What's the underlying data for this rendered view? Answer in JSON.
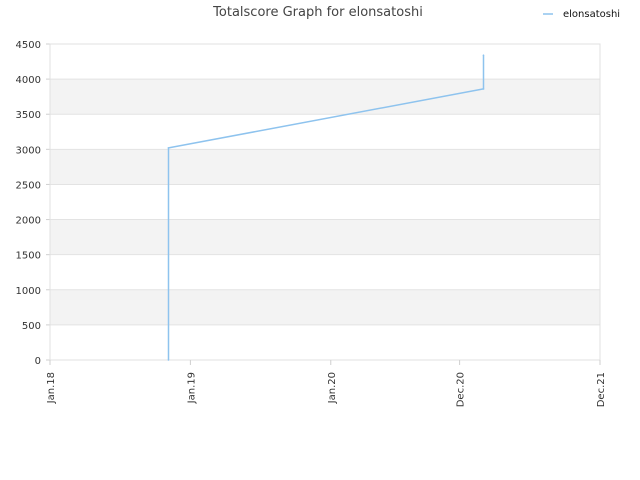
{
  "chart_data": {
    "type": "line",
    "title": "Totalscore Graph for elonsatoshi",
    "xlabel": "",
    "ylabel": "",
    "ylim": [
      0,
      4500
    ],
    "y_ticks": [
      "0",
      "500",
      "1000",
      "1500",
      "2000",
      "2500",
      "3000",
      "3500",
      "4000",
      "4500"
    ],
    "x_ticks": [
      {
        "label": "Jan.18",
        "date": "2018-01-01"
      },
      {
        "label": "Jan.19",
        "date": "2019-01-01"
      },
      {
        "label": "Jan.20",
        "date": "2020-01-01"
      },
      {
        "label": "Dec.20",
        "date": "2020-12-01"
      },
      {
        "label": "Dec.21",
        "date": "2021-12-01"
      }
    ],
    "xlim": [
      "2018-01-01",
      "2021-12-01"
    ],
    "grid": true,
    "alternate_band_color": "#f3f3f3",
    "legend_position": "top-right",
    "series": [
      {
        "name": "elonsatoshi",
        "color": "#8ec3ee",
        "points": [
          {
            "x": "2018-11-05",
            "y": 0
          },
          {
            "x": "2018-11-05",
            "y": 3020
          },
          {
            "x": "2021-02-01",
            "y": 3860
          },
          {
            "x": "2021-02-01",
            "y": 4340
          }
        ]
      }
    ]
  }
}
